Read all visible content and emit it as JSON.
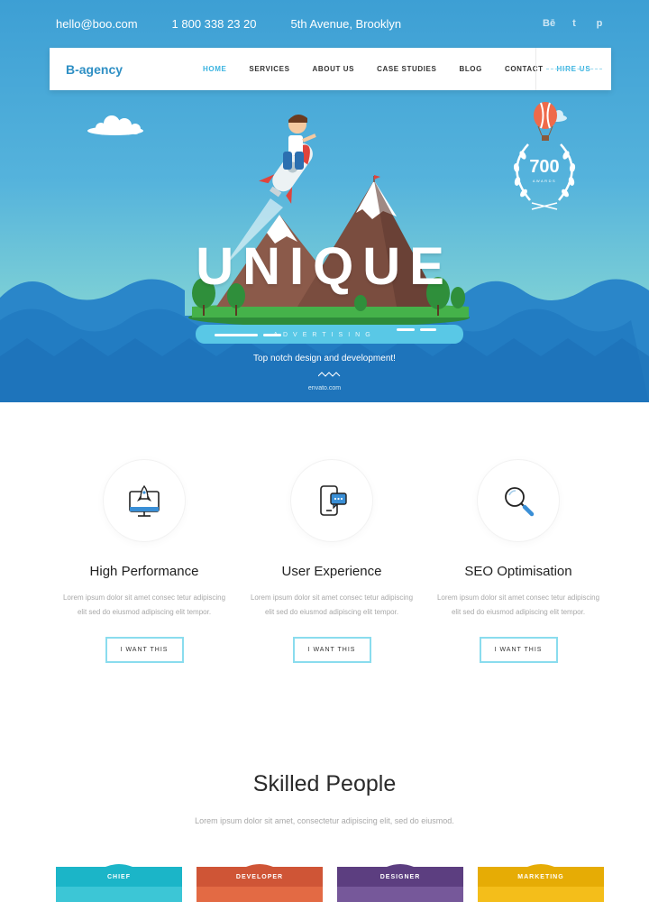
{
  "topbar": {
    "email": "hello@boo.com",
    "phone": "1 800 338 23 20",
    "address": "5th Avenue, Brooklyn",
    "social": [
      "Bē",
      "t",
      "p"
    ]
  },
  "nav": {
    "brand": "B-agency",
    "items": [
      "HOME",
      "SERVICES",
      "ABOUT US",
      "CASE STUDIES",
      "BLOG",
      "CONTACT"
    ],
    "hire": "HIRE US"
  },
  "hero": {
    "title": "UNIQUE",
    "subtitle": "ADVERTISING",
    "tagline": "Top notch design and development!",
    "watermark": "envato.com",
    "award_number": "700",
    "award_label": "AWARDS"
  },
  "features": [
    {
      "icon": "rocket-monitor-icon",
      "title": "High Performance",
      "desc": "Lorem ipsum dolor sit amet consec tetur adipiscing elit sed do eiusmod adipiscing elit tempor.",
      "button": "I WANT THIS"
    },
    {
      "icon": "phone-chat-icon",
      "title": "User Experience",
      "desc": "Lorem ipsum dolor sit amet consec tetur adipiscing elit sed do eiusmod adipiscing elit tempor.",
      "button": "I WANT THIS"
    },
    {
      "icon": "magnifier-icon",
      "title": "SEO Optimisation",
      "desc": "Lorem ipsum dolor sit amet consec tetur adipiscing elit sed do eiusmod adipiscing elit tempor.",
      "button": "I WANT THIS"
    }
  ],
  "skilled": {
    "title": "Skilled People",
    "subtitle": "Lorem ipsum dolor sit amet, consectetur adipiscing elit, sed do eiusmod.",
    "team": [
      {
        "label": "CHIEF",
        "color": "#1bb5c8",
        "body": "#3cc6d6"
      },
      {
        "label": "DEVELOPER",
        "color": "#cf5536",
        "body": "#e36a44"
      },
      {
        "label": "DESIGNER",
        "color": "#5c3e80",
        "body": "#76589a"
      },
      {
        "label": "MARKETING",
        "color": "#e6ac05",
        "body": "#f4be1a"
      }
    ]
  }
}
